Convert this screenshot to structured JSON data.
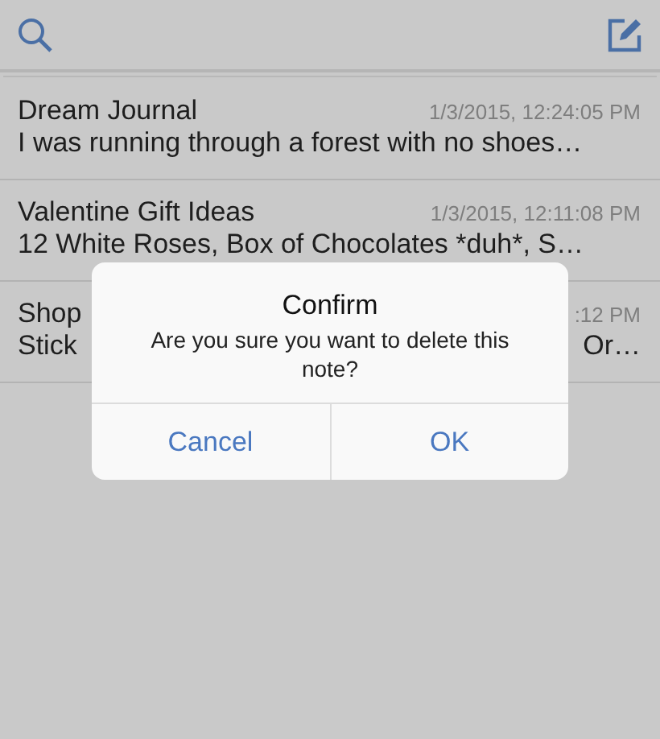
{
  "notes": [
    {
      "title": "Dream Journal",
      "date": "1/3/2015, 12:24:05 PM",
      "preview": "I was running through a forest with no shoes…"
    },
    {
      "title": "Valentine Gift Ideas",
      "date": "1/3/2015, 12:11:08 PM",
      "preview": "12 White Roses, Box of Chocolates *duh*, S…"
    },
    {
      "title": "Shop",
      "date": ":12 PM",
      "preview": [
        "Stick",
        "Or…"
      ]
    }
  ],
  "dialog": {
    "title": "Confirm",
    "message": "Are you sure you want to delete this note?",
    "buttons": [
      "Cancel",
      "OK"
    ]
  }
}
